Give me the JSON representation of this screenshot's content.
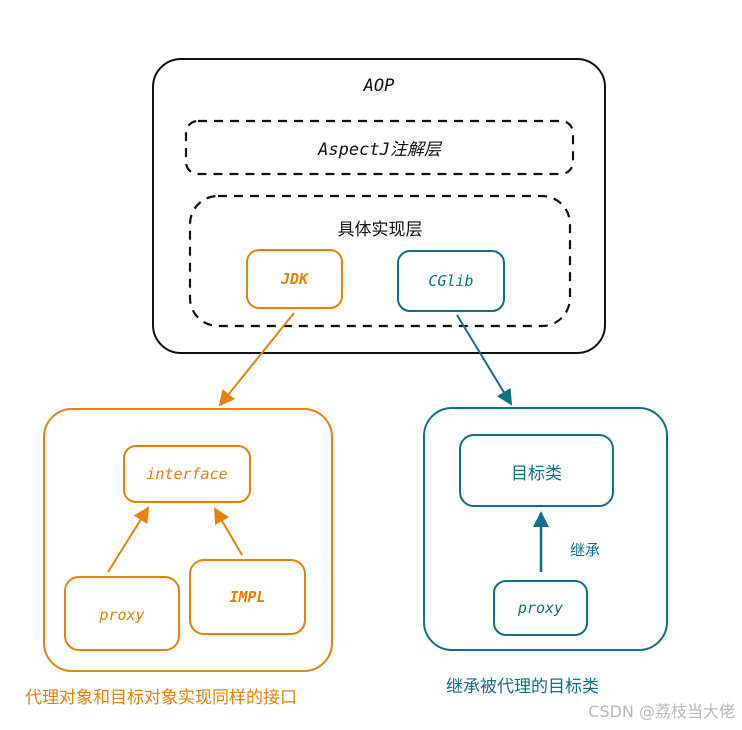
{
  "colors": {
    "black": "#111111",
    "orange": "#e8800c",
    "teal": "#0e7282",
    "watermark": "#b8b8b8"
  },
  "aop": {
    "title": "AOP",
    "aspectj_layer": "AspectJ注解层",
    "impl_layer": {
      "title": "具体实现层",
      "jdk": "JDK",
      "cglib": "CGlib"
    }
  },
  "jdk_group": {
    "interface": "interface",
    "proxy": "proxy",
    "impl": "IMPL",
    "caption": "代理对象和目标对象实现同样的接口"
  },
  "cglib_group": {
    "target_class": "目标类",
    "inherit_label": "继承",
    "proxy": "proxy",
    "caption": "继承被代理的目标类"
  },
  "watermark": "CSDN @荔枝当大佬"
}
